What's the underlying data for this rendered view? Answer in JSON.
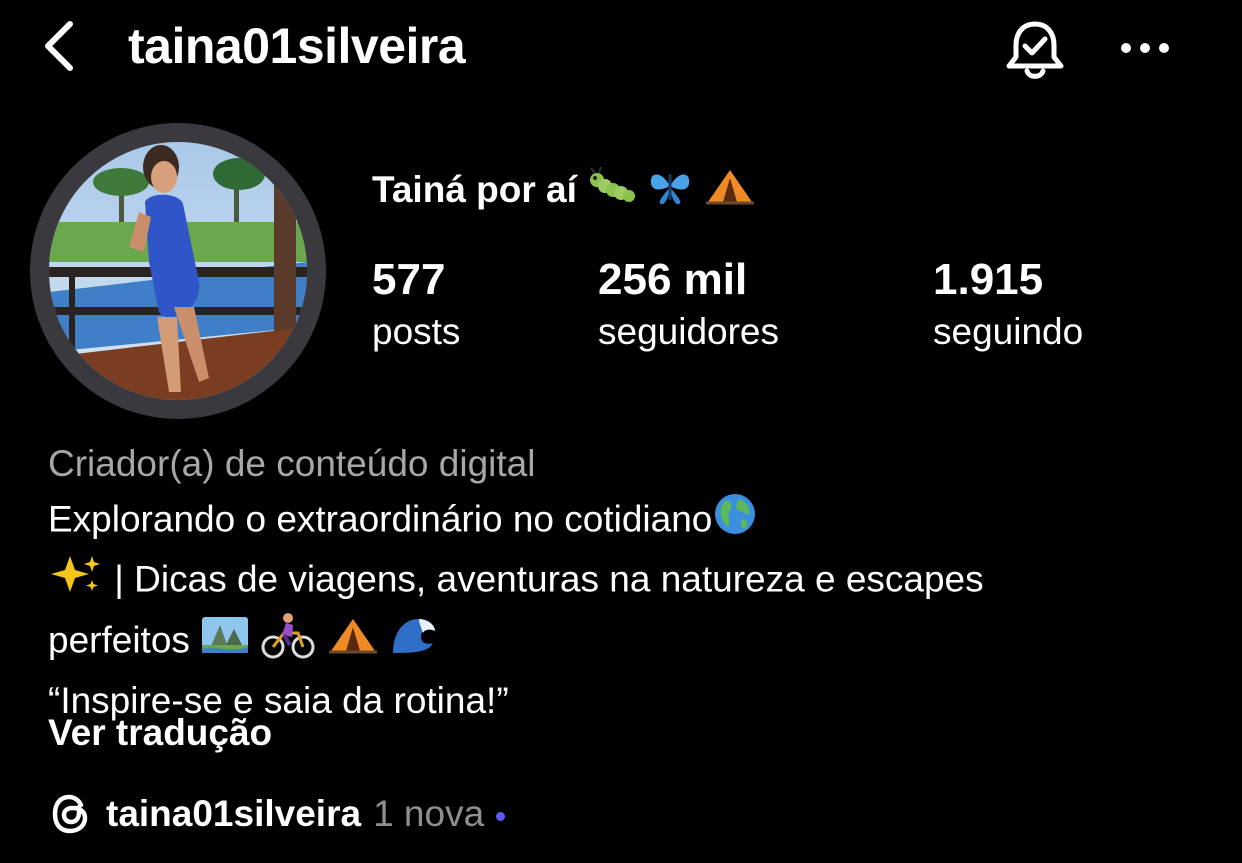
{
  "header": {
    "username": "taina01silveira"
  },
  "profile": {
    "display_name": "Tainá por aí",
    "display_name_emojis": [
      "caterpillar-emoji",
      "butterfly-emoji",
      "tent-emoji"
    ]
  },
  "stats": [
    {
      "value": "577",
      "label": "posts"
    },
    {
      "value": "256 mil",
      "label": "seguidores"
    },
    {
      "value": "1.915",
      "label": "seguindo"
    }
  ],
  "bio": {
    "category": "Criador(a) de conteúdo digital",
    "line1": "Explorando o extraordinário no cotidiano",
    "line2": " | Dicas de viagens, aventuras na natureza e escapes",
    "line3": "perfeitos ",
    "line4": "“Inspire-se e saia da rotina!”",
    "translate_label": "Ver tradução"
  },
  "threads": {
    "handle": "taina01silveira",
    "new_label": "1 nova",
    "dot_color": "#5b5bf5"
  },
  "colors": {
    "background": "#000000",
    "text": "#ffffff",
    "muted": "#a6a6ab"
  }
}
